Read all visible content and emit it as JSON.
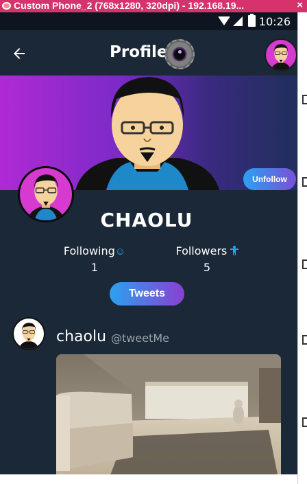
{
  "window": {
    "title": "Custom Phone_2 (768x1280, 320dpi) - 192.168.19..."
  },
  "statusbar": {
    "time": "10:26"
  },
  "appbar": {
    "title": "Profile",
    "back_icon": "arrow-left-icon",
    "lens_icon": "camera-lens-icon"
  },
  "profile": {
    "username": "CHAOLU",
    "following_label": "Following",
    "following_count": "1",
    "followers_label": "Followers",
    "followers_count": "5",
    "unfollow_label": "Unfollow",
    "tweets_label": "Tweets"
  },
  "tweet": {
    "name": "chaolu",
    "handle": "@tweetMe"
  },
  "colors": {
    "background": "#1b2838",
    "accent_blue": "#2aa2f0",
    "accent_purple": "#8b3fd0",
    "banner_start": "#b02ad4",
    "avatar_bg": "#d63ad0"
  }
}
